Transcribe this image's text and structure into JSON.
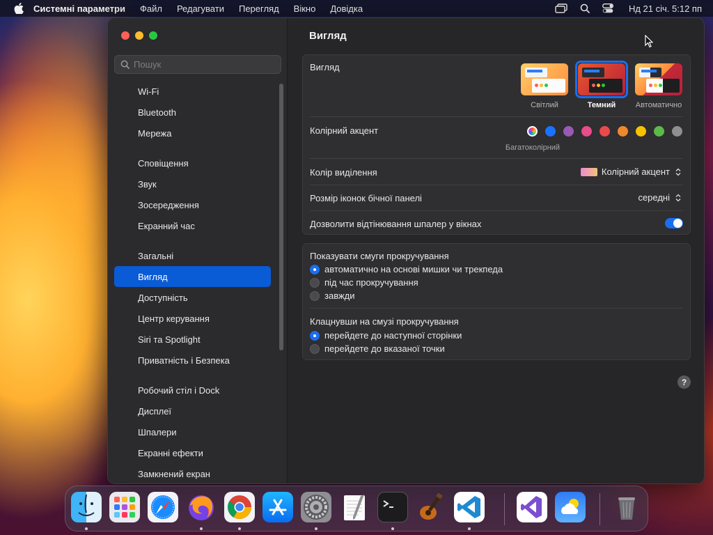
{
  "menubar": {
    "app_name": "Системні параметри",
    "items": [
      "Файл",
      "Редагувати",
      "Перегляд",
      "Вікно",
      "Довідка"
    ],
    "clock": "Нд 21 січ.  5:12 пп",
    "right_icons": [
      "screen-mirroring-icon",
      "search-icon",
      "control-center-icon"
    ]
  },
  "sidebar": {
    "search_placeholder": "Пошук",
    "groups": [
      [
        "Wi-Fi",
        "Bluetooth",
        "Мережа"
      ],
      [
        "Сповіщення",
        "Звук",
        "Зосередження",
        "Екранний час"
      ],
      [
        "Загальні",
        "Вигляд",
        "Доступність",
        "Центр керування",
        "Siri та Spotlight",
        "Приватність і Безпека"
      ],
      [
        "Робочий стіл і Dock",
        "Дисплеї",
        "Шпалери",
        "Екранні ефекти",
        "Замкнений екран"
      ]
    ],
    "selected": "Вигляд"
  },
  "content": {
    "title": "Вигляд",
    "appearance": {
      "label": "Вигляд",
      "options": [
        "Світлий",
        "Темний",
        "Автоматично"
      ],
      "selected": "Темний"
    },
    "accent": {
      "label": "Колірний акцент",
      "caption": "Багатоколірний",
      "colors": [
        "#8f62d8",
        "#1a73ff",
        "#9b59b6",
        "#e84c8a",
        "#ec4a4a",
        "#f0892b",
        "#f5c400",
        "#5cb94a",
        "#8e8e93"
      ]
    },
    "highlight": {
      "label": "Колір виділення",
      "value": "Колірний акцент"
    },
    "sidebar_icon_size": {
      "label": "Розмір іконок бічної панелі",
      "value": "середні"
    },
    "wallpaper_tinting": {
      "label": "Дозволити відтінювання шпалер у вікнах",
      "enabled": true
    },
    "scrollbars": {
      "label": "Показувати смуги прокручування",
      "options": [
        "автоматично на основі мишки чи трекпеда",
        "під час прокручування",
        "завжди"
      ],
      "selected": 0
    },
    "scroll_click": {
      "label": "Клацнувши на смузі прокручування",
      "options": [
        "перейдете до наступної сторінки",
        "перейдете до вказаної точки"
      ],
      "selected": 0
    },
    "help": "?"
  },
  "dock": {
    "apps": [
      "finder",
      "launchpad",
      "safari",
      "firefox",
      "chrome",
      "app-store",
      "system-settings",
      "textedit",
      "terminal",
      "garageband",
      "vscode",
      "visual-studio",
      "weather",
      "trash"
    ]
  }
}
